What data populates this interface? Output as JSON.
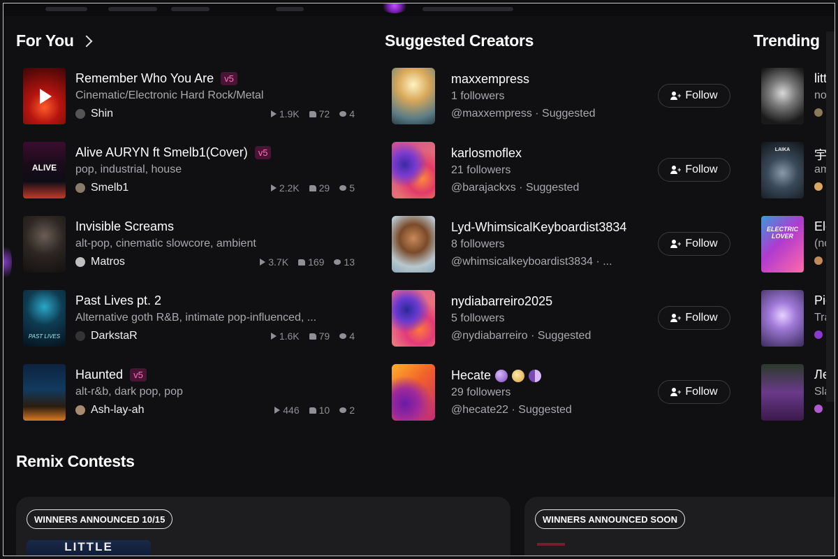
{
  "sections": {
    "for_you": "For You",
    "suggested": "Suggested Creators",
    "trending": "Trending",
    "remix": "Remix Contests"
  },
  "songs": [
    {
      "title": "Remember Who You Are",
      "badge": "v5",
      "genre": "Cinematic/Electronic Hard Rock/Metal",
      "author": "Shin",
      "plays": "1.9K",
      "likes": "72",
      "comments": "4"
    },
    {
      "title": "Alive AURYN ft Smelb1(Cover)",
      "badge": "v5",
      "genre": "pop, industrial, house",
      "author": "Smelb1",
      "plays": "2.2K",
      "likes": "29",
      "comments": "5"
    },
    {
      "title": "Invisible Screams",
      "badge": "",
      "genre": "alt-pop, cinematic slowcore, ambient",
      "author": "Matros",
      "plays": "3.7K",
      "likes": "169",
      "comments": "13"
    },
    {
      "title": "Past Lives pt. 2",
      "badge": "",
      "genre": "Alternative goth R&B, intimate pop-influenced, ...",
      "author": "DarkstaR",
      "plays": "1.6K",
      "likes": "79",
      "comments": "4"
    },
    {
      "title": "Haunted",
      "badge": "v5",
      "genre": "alt-r&b, dark pop, pop",
      "author": "Ash-lay-ah",
      "plays": "446",
      "likes": "10",
      "comments": "2"
    }
  ],
  "cover_text": {
    "alive": "ALIVE",
    "past_lives": "PAST LIVES"
  },
  "creators": [
    {
      "name": "maxxempress",
      "followers": "1 followers",
      "handle": "@maxxempress · Suggested"
    },
    {
      "name": "karlosmoflex",
      "followers": "21 followers",
      "handle": "@barajackxs · Suggested"
    },
    {
      "name": "Lyd-WhimsicalKeyboardist3834",
      "followers": "8 followers",
      "handle": "@whimsicalkeyboardist3834 · ..."
    },
    {
      "name": "nydiabarreiro2025",
      "followers": "5 followers",
      "handle": "@nydiabarreiro · Suggested"
    },
    {
      "name": "Hecate",
      "followers": "29 followers",
      "handle": "@hecate22 · Suggested"
    }
  ],
  "follow_label": "Follow",
  "trending": [
    {
      "t1": "litt",
      "t2": "nor"
    },
    {
      "t1": "宇",
      "t2": "am"
    },
    {
      "t1": "Ele",
      "t2": "(no"
    },
    {
      "t1": "Pic",
      "t2": "Tra"
    },
    {
      "t1": "Ле",
      "t2": "Sla"
    }
  ],
  "trending_cover_text": {
    "laika": "LAIKA",
    "electric": "ELECTRIC LOVER"
  },
  "contests": [
    {
      "pill": "WINNERS ANNOUNCED 10/15",
      "cover_text": "LITTLE"
    },
    {
      "pill": "WINNERS ANNOUNCED SOON"
    }
  ]
}
